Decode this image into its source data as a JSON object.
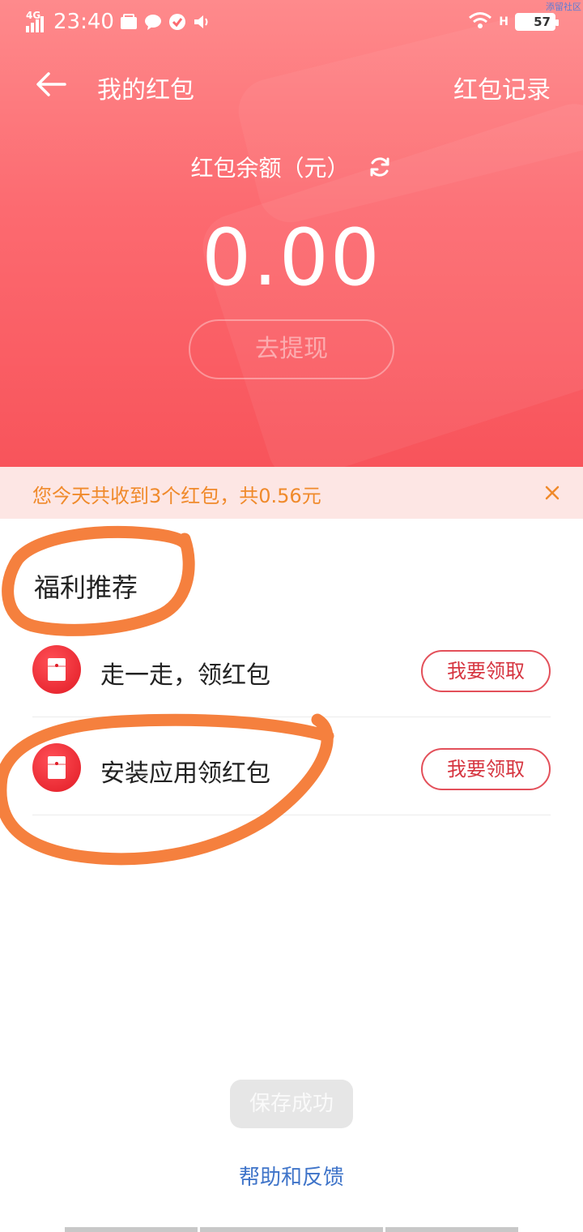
{
  "status_bar": {
    "network": "4G",
    "time": "23:40",
    "battery": "57",
    "watermark": "添留社区"
  },
  "header": {
    "title": "我的红包",
    "record_link": "红包记录"
  },
  "balance": {
    "label": "红包余额（元）",
    "amount": "0.00",
    "withdraw_label": "去提现"
  },
  "notice": {
    "text": "您今天共收到3个红包，共0.56元"
  },
  "recommend": {
    "title": "福利推荐",
    "items": [
      {
        "label": "走一走，领红包",
        "button": "我要领取"
      },
      {
        "label": "安装应用领红包",
        "button": "我要领取"
      }
    ]
  },
  "toast": {
    "text": "保存成功"
  },
  "footer": {
    "help": "帮助和反馈"
  },
  "colors": {
    "accent": "#f8545b",
    "notice_text": "#f08a2b",
    "link": "#3f74c9",
    "annotation": "#f5803e"
  }
}
